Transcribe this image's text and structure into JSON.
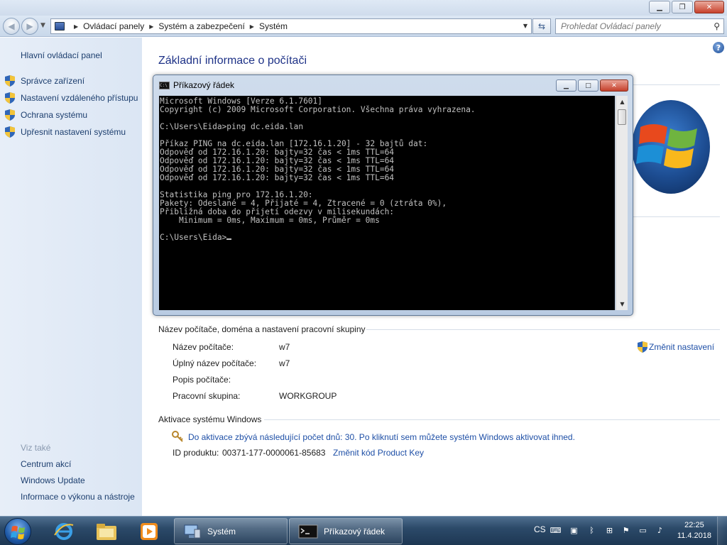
{
  "address_bar": {
    "breadcrumbs": [
      "Ovládací panely",
      "Systém a zabezpečení",
      "Systém"
    ],
    "search_placeholder": "Prohledat Ovládací panely"
  },
  "sidebar": {
    "home": "Hlavní ovládací panel",
    "tasks": [
      {
        "label": "Správce zařízení",
        "icon": "shield-icon"
      },
      {
        "label": "Nastavení vzdáleného přístupu",
        "icon": "shield-icon"
      },
      {
        "label": "Ochrana systému",
        "icon": "shield-icon"
      },
      {
        "label": "Upřesnit nastavení systému",
        "icon": "shield-icon"
      }
    ],
    "see_also_label": "Viz také",
    "see_also": [
      "Centrum akcí",
      "Windows Update",
      "Informace o výkonu a nástroje"
    ]
  },
  "main": {
    "title": "Základní informace o počítači",
    "computer_section": {
      "heading": "Název počítače, doména a nastavení pracovní skupiny",
      "change_settings": "Změnit nastavení",
      "rows": [
        {
          "label": "Název počítače:",
          "value": "w7"
        },
        {
          "label": "Úplný název počítače:",
          "value": "w7"
        },
        {
          "label": "Popis počítače:",
          "value": ""
        },
        {
          "label": "Pracovní skupina:",
          "value": "WORKGROUP"
        }
      ]
    },
    "activation_section": {
      "heading": "Aktivace systému Windows",
      "activation_link": "Do aktivace zbývá následující počet dnů: 30. Po kliknutí sem můžete systém Windows aktivovat ihned.",
      "product_id_label": "ID produktu:",
      "product_id": "00371-177-0000061-85683",
      "change_key": "Změnit kód Product Key"
    }
  },
  "cmd_window": {
    "title": "Příkazový řádek",
    "lines": [
      "Microsoft Windows [Verze 6.1.7601]",
      "Copyright (c) 2009 Microsoft Corporation. Všechna práva vyhrazena.",
      "",
      "C:\\Users\\Eida>ping dc.eida.lan",
      "",
      "Příkaz PING na dc.eida.lan [172.16.1.20] - 32 bajtů dat:",
      "Odpověď od 172.16.1.20: bajty=32 čas < 1ms TTL=64",
      "Odpověď od 172.16.1.20: bajty=32 čas < 1ms TTL=64",
      "Odpověď od 172.16.1.20: bajty=32 čas < 1ms TTL=64",
      "Odpověď od 172.16.1.20: bajty=32 čas < 1ms TTL=64",
      "",
      "Statistika ping pro 172.16.1.20:",
      "Pakety: Odeslané = 4, Přijaté = 4, Ztracené = 0 (ztráta 0%),",
      "Přibližná doba do přijetí odezvy v milisekundách:",
      "    Minimum = 0ms, Maximum = 0ms, Průměr = 0ms",
      ""
    ],
    "prompt": "C:\\Users\\Eida>"
  },
  "taskbar": {
    "tasks": [
      {
        "label": "Systém",
        "icon": "computer-icon"
      },
      {
        "label": "Příkazový řádek",
        "icon": "cmd-icon"
      }
    ],
    "pinned": [
      "internet-explorer-icon",
      "explorer-folder-icon",
      "media-player-icon"
    ],
    "language": "CS",
    "tray_icons": [
      "keyboard-icon",
      "vm-icon",
      "bluetooth-icon",
      "network-icon",
      "flag-icon",
      "display-icon",
      "volume-icon"
    ],
    "time": "22:25",
    "date": "11.4.2018"
  },
  "colors": {
    "link": "#1e4fa6",
    "title": "#1e3287",
    "sidebar_link": "#1c3e6e",
    "console_bg": "#000000",
    "console_fg": "#c0c0c0"
  }
}
